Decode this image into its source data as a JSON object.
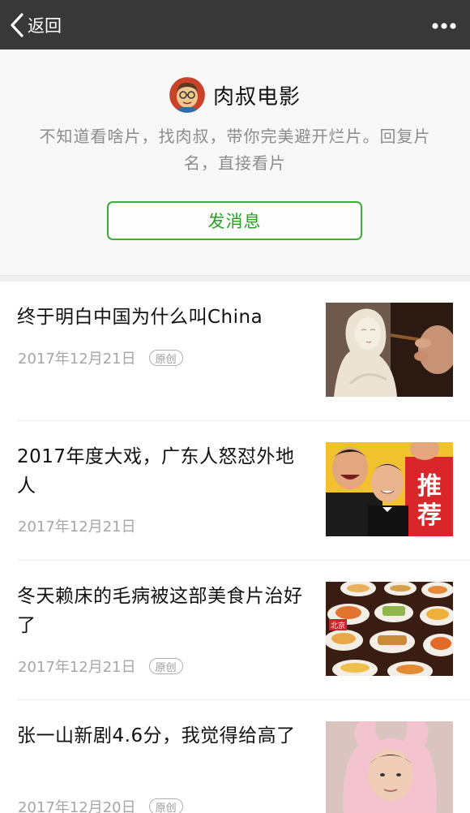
{
  "nav": {
    "back_label": "返回",
    "back_icon": "chevron-left-icon",
    "more_icon": "more-dots-icon"
  },
  "account": {
    "name": "肉叔电影",
    "description": "不知道看啥片，找肉叔，带你完美避开烂片。回复片名，直接看片",
    "message_button": "发消息",
    "accent_color": "#2aa123"
  },
  "articles": [
    {
      "title": "终于明白中国为什么叫China",
      "date": "2017年12月21日",
      "tag": "原创"
    },
    {
      "title": "2017年度大戏，广东人怒怼外地人",
      "date": "2017年12月21日",
      "tag": ""
    },
    {
      "title": "冬天赖床的毛病被这部美食片治好了",
      "date": "2017年12月21日",
      "tag": "原创"
    },
    {
      "title": "张一山新剧4.6分，我觉得给高了",
      "date": "2017年12月20日",
      "tag": "原创"
    }
  ],
  "thumbnails": {
    "poster_text": "推荐",
    "food_label": "北京"
  }
}
